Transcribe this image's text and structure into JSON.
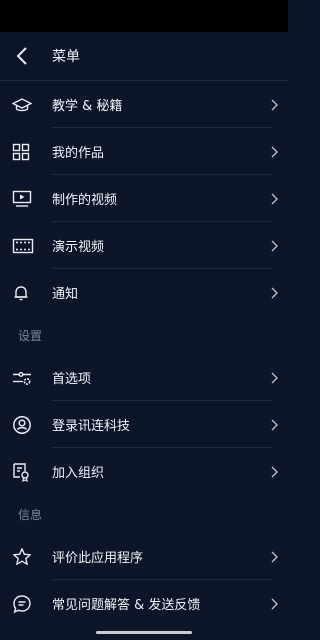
{
  "header": {
    "title": "菜单"
  },
  "menu": [
    {
      "label": "教学 & 秘籍",
      "icon": "graduation-cap-icon"
    },
    {
      "label": "我的作品",
      "icon": "grid-icon"
    },
    {
      "label": "制作的视频",
      "icon": "video-monitor-icon"
    },
    {
      "label": "演示视频",
      "icon": "filmstrip-icon"
    },
    {
      "label": "通知",
      "icon": "bell-icon"
    }
  ],
  "settings": {
    "title": "设置",
    "items": [
      {
        "label": "首选项",
        "icon": "sliders-icon"
      },
      {
        "label": "登录讯连科技",
        "icon": "account-icon"
      },
      {
        "label": "加入组织",
        "icon": "organization-badge-icon"
      }
    ]
  },
  "info": {
    "title": "信息",
    "items": [
      {
        "label": "评价此应用程序",
        "icon": "star-icon"
      },
      {
        "label": "常见问题解答 & 发送反馈",
        "icon": "faq-chat-icon"
      }
    ]
  },
  "colors": {
    "background": "#0c1628",
    "divider": "#1e2a3e",
    "text": "#f1f3f8",
    "section": "#7d8799"
  }
}
